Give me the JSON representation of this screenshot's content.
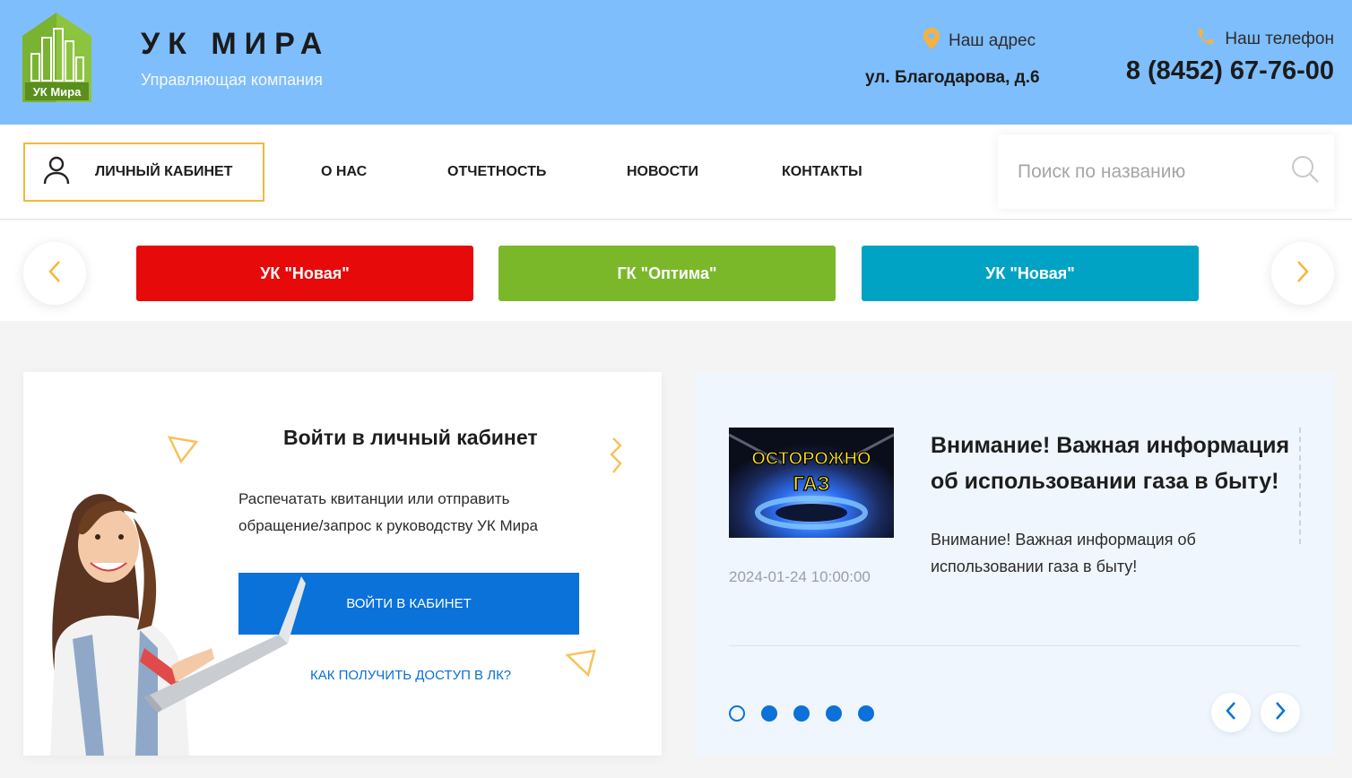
{
  "header": {
    "logo_text": "УК Мира",
    "brand": "УК МИРА",
    "subtitle": "Управляющая компания",
    "address_label": "Наш адрес",
    "address": "ул. Благодарова, д.6",
    "phone_label": "Наш телефон",
    "phone": "8 (8452) 67-76-00"
  },
  "nav": {
    "cabinet_label": "ЛИЧНЫЙ КАБИНЕТ",
    "links": [
      "О НАС",
      "ОТЧЕТНОСТЬ",
      "НОВОСТИ",
      "КОНТАКТЫ"
    ],
    "search_placeholder": "Поиск по названию"
  },
  "companies": [
    {
      "label": "УК \"Новая\"",
      "color": "#e60a0a"
    },
    {
      "label": "ГК \"Оптима\"",
      "color": "#7ab82a"
    },
    {
      "label": "УК \"Новая\"",
      "color": "#00a3c4"
    }
  ],
  "login": {
    "title": "Войти в личный кабинет",
    "description": "Распечатать квитанции или отправить обращение/запрос к руководству УК Мира",
    "button": "ВОЙТИ В КАБИНЕТ",
    "link": "КАК ПОЛУЧИТЬ ДОСТУП В ЛК?"
  },
  "news": {
    "image_text_1": "ОСТОРОЖНО",
    "image_text_2": "ГАЗ",
    "date": "2024-01-24 10:00:00",
    "title": "Внимание! Важная информация об использовании газа в быту!",
    "text": "Внимание! Важная информация об использовании газа в быту!",
    "dots_total": 5,
    "active_dot": 1
  },
  "colors": {
    "header_bg": "#7fbefc",
    "accent": "#f5b73a",
    "primary": "#0a72d9"
  }
}
